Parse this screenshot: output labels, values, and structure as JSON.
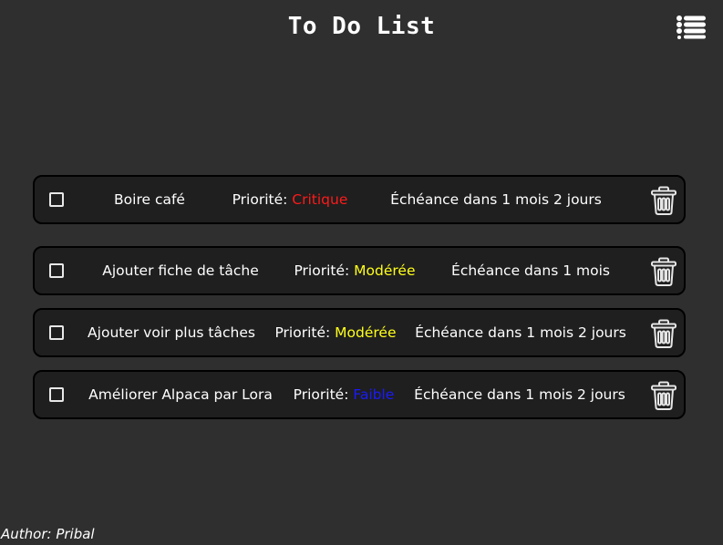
{
  "header": {
    "title": "To Do List",
    "menu_icon": "hamburger-list-icon"
  },
  "tasks": [
    {
      "name": "Boire café",
      "priority_label": "Priorité: ",
      "priority": "Critique",
      "priority_color": "#ff1a1a",
      "due": "Échéance dans 1 mois 2 jours",
      "checked": false
    },
    {
      "name": "Ajouter fiche de tâche",
      "priority_label": "Priorité: ",
      "priority": "Modérée",
      "priority_color": "#ffff1a",
      "due": "Échéance dans 1 mois",
      "checked": false
    },
    {
      "name": "Ajouter voir plus tâches",
      "priority_label": "Priorité: ",
      "priority": "Modérée",
      "priority_color": "#ffff1a",
      "due": "Échéance dans 1 mois 2 jours",
      "checked": false
    },
    {
      "name": "Améliorer Alpaca par Lora",
      "priority_label": "Priorité: ",
      "priority": "Faible",
      "priority_color": "#1a1aff",
      "due": "Échéance dans 1 mois 2 jours",
      "checked": false
    }
  ],
  "icons": {
    "checkbox": "checkbox-icon",
    "delete": "trash-icon"
  },
  "footer": {
    "author": "Author: Pribal"
  },
  "colors": {
    "background": "#2f2f2f",
    "card": "#1f1f1f",
    "text": "#ffffff",
    "critical": "#ff1a1a",
    "moderate": "#ffff1a",
    "low": "#1a1aff"
  }
}
